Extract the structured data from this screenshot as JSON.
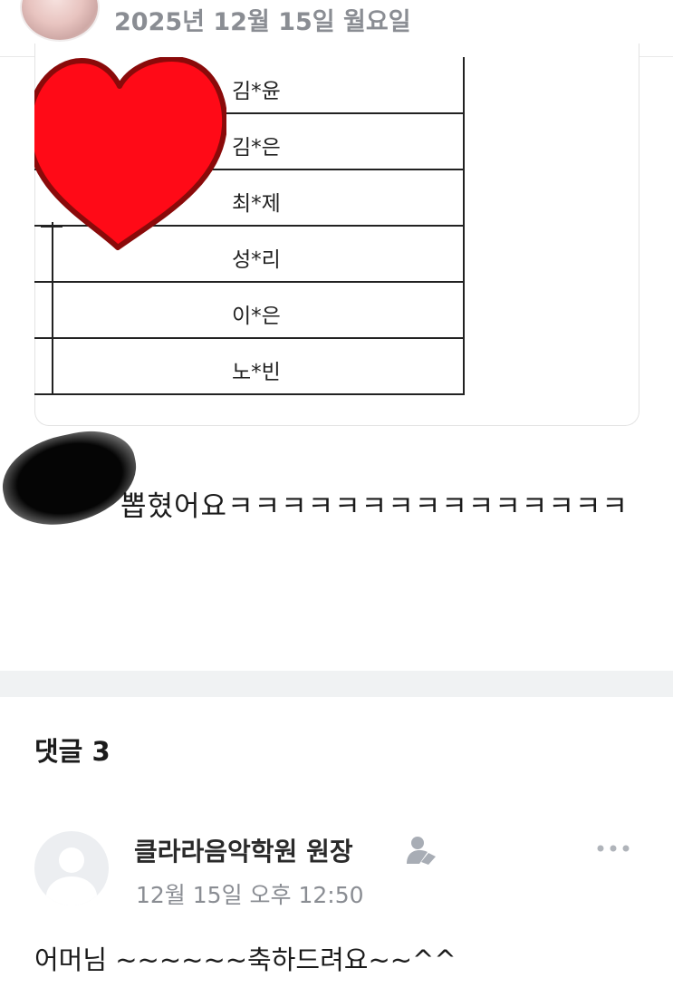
{
  "post": {
    "date": "2025년 12월 15일 월요일",
    "names": [
      "김*윤",
      "김*은",
      "최*제",
      "성*리",
      "이*은",
      "노*빈"
    ],
    "text": "뽑혔어요ㅋㅋㅋㅋㅋㅋㅋㅋㅋㅋㅋㅋㅋㅋㅋ"
  },
  "comments_section": {
    "title": "댓글 3"
  },
  "comment": {
    "author": "클라라음악학원 원장",
    "time": "12월 15일 오후 12:50",
    "body": "어머님 ~~~~~~축하드려요~~^^"
  },
  "icons": {
    "avatar": "user-avatar-photo",
    "heart": "heart-sticker",
    "verify": "verified-person-icon",
    "more": "more-dots-icon",
    "default_avatar": "default-user-icon"
  },
  "colors": {
    "heart_fill": "#ff0a17",
    "heart_stroke": "#8a0a0a",
    "date_gray": "#8a8d93",
    "separator": "#f0f2f3"
  }
}
